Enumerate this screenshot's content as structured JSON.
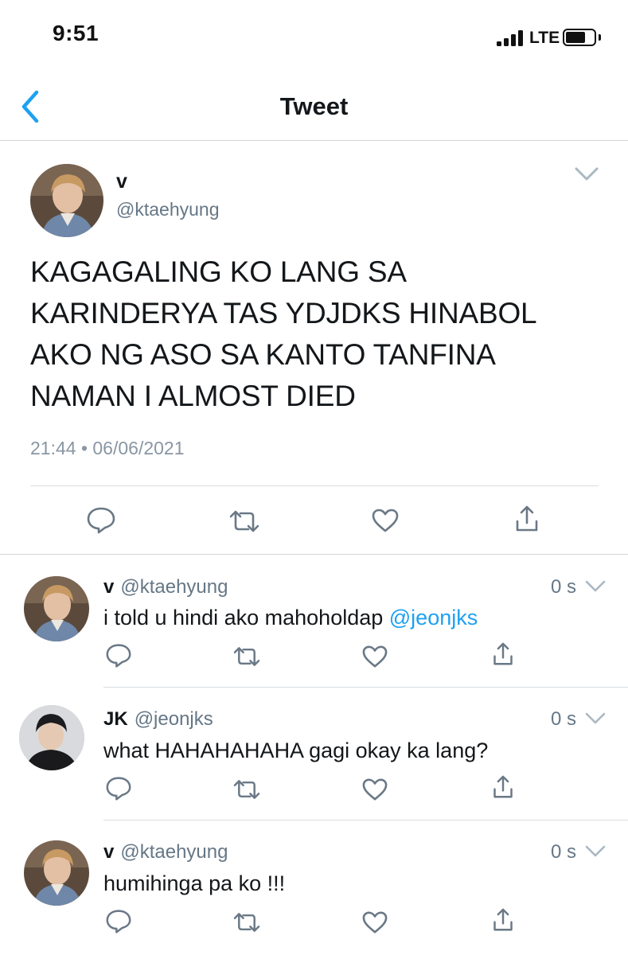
{
  "status_bar": {
    "time": "9:51",
    "network": "LTE",
    "signal_bars": 4,
    "battery_level": 0.6
  },
  "nav": {
    "title": "Tweet",
    "back_icon": "chevron-left-icon",
    "accent": "#1da1f2"
  },
  "main_tweet": {
    "name": "v",
    "handle": "@ktaehyung",
    "text": "KAGAGALING KO LANG SA KARINDERYA TAS YDJDKS HINABOL AKO NG ASO SA KANTO TANFINA NAMAN I ALMOST DIED",
    "timestamp": "21:44 • 06/06/2021",
    "actions": [
      "reply-icon",
      "retweet-icon",
      "like-icon",
      "share-icon"
    ]
  },
  "replies": [
    {
      "name": "v",
      "handle": "@ktaehyung",
      "time": "0 s",
      "text": "i told u hindi ako mahoholdap ",
      "mention": "@jeonjks"
    },
    {
      "name": "JK",
      "handle": "@jeonjks",
      "time": "0 s",
      "text": "what HAHAHAHAHA gagi okay ka lang?"
    },
    {
      "name": "v",
      "handle": "@ktaehyung",
      "time": "0 s",
      "text": "humihinga pa ko !!!"
    }
  ],
  "colors": {
    "text": "#14171a",
    "secondary": "#657786",
    "icon": "#6a7886",
    "link": "#1da1f2",
    "divider": "#d9dde1"
  }
}
